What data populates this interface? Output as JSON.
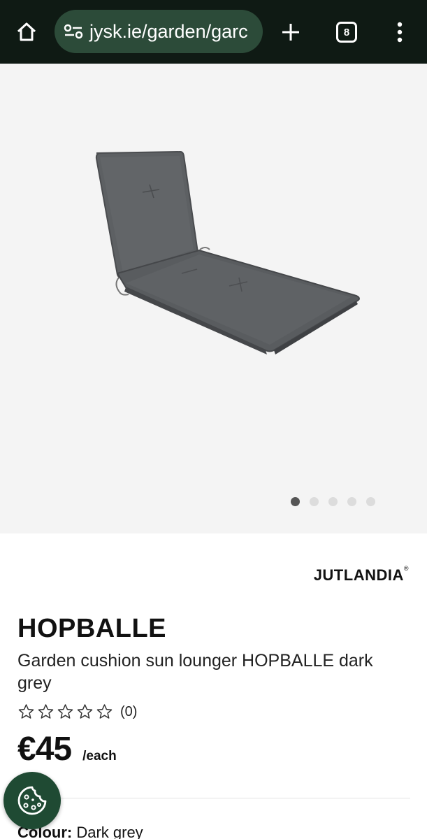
{
  "browser": {
    "url": "jysk.ie/garden/garc",
    "tab_count": "8",
    "icons": [
      "home-icon",
      "site-settings-icon",
      "plus-icon",
      "tabs-icon",
      "more-vert-icon"
    ],
    "colors": {
      "bar": "#0f1a14",
      "url_pill": "#2c4b39"
    }
  },
  "gallery": {
    "image_alt": "Dark grey sun lounger cushion",
    "dot_count": 5,
    "active_dot": 0
  },
  "product": {
    "brand": "JUTLANDIA",
    "brand_mark": "®",
    "name": "HOPBALLE",
    "description": "Garden cushion sun lounger HOPBALLE dark grey",
    "rating_stars": 0,
    "rating_max": 5,
    "rating_count": "(0)",
    "price": "€45",
    "unit": "/each",
    "colour_label": "Colour:",
    "colour_value": "Dark grey"
  },
  "cookie": {
    "icon": "cookie-icon",
    "color": "#1f4a33"
  }
}
